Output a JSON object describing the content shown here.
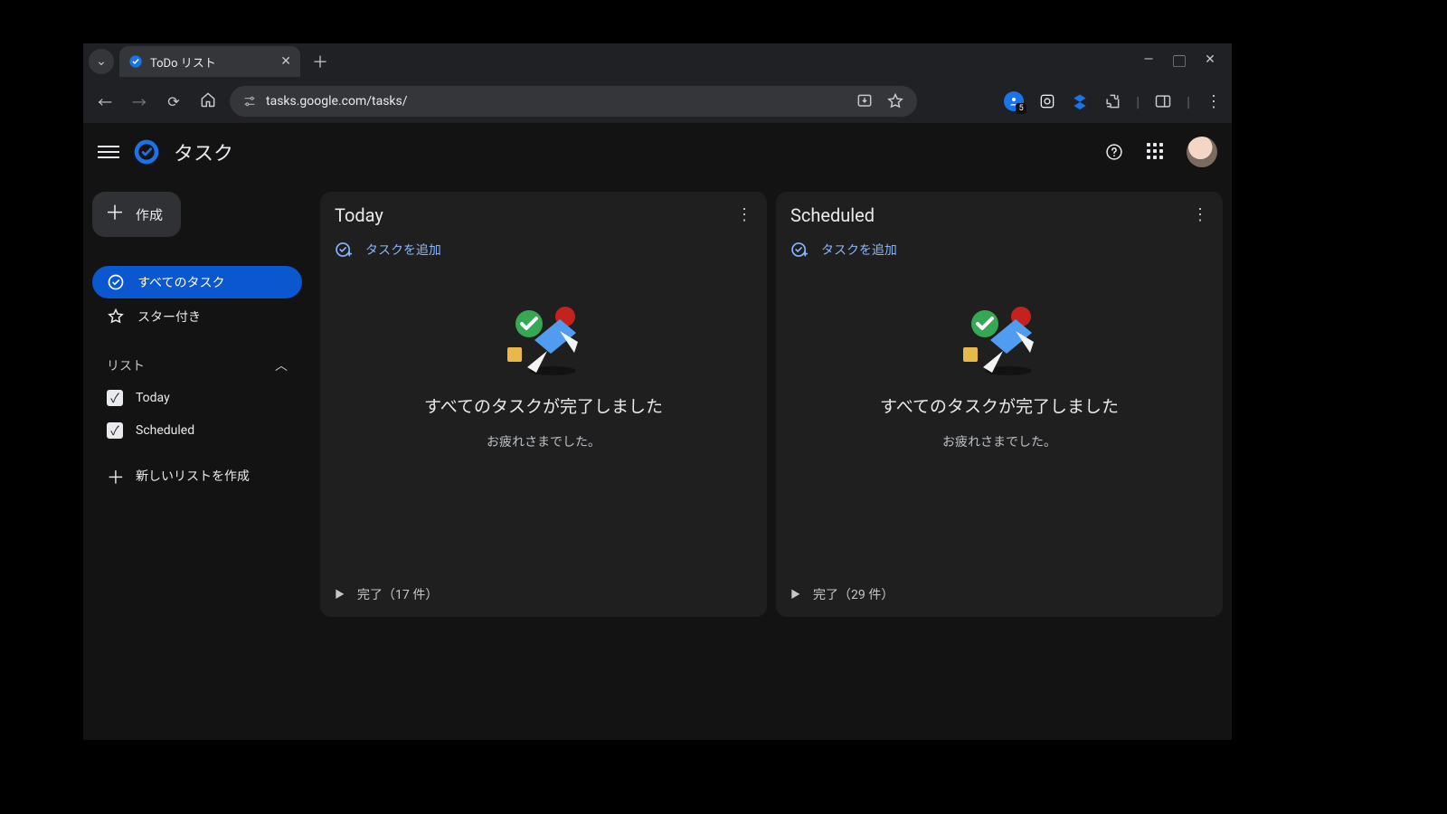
{
  "browser": {
    "tab_title": "ToDo リスト",
    "url": "tasks.google.com/tasks/",
    "extension_badge_count": "5"
  },
  "app": {
    "title": "タスク"
  },
  "sidebar": {
    "create_label": "作成",
    "all_tasks_label": "すべてのタスク",
    "starred_label": "スター付き",
    "lists_header": "リスト",
    "lists": [
      {
        "label": "Today",
        "checked": true
      },
      {
        "label": "Scheduled",
        "checked": true
      }
    ],
    "new_list_label": "新しいリストを作成"
  },
  "boards": [
    {
      "title": "Today",
      "add_task_label": "タスクを追加",
      "empty_heading": "すべてのタスクが完了しました",
      "empty_sub": "お疲れさまでした。",
      "completed_label": "完了（17 件）",
      "completed_count": 17
    },
    {
      "title": "Scheduled",
      "add_task_label": "タスクを追加",
      "empty_heading": "すべてのタスクが完了しました",
      "empty_sub": "お疲れさまでした。",
      "completed_label": "完了（29 件）",
      "completed_count": 29
    }
  ]
}
